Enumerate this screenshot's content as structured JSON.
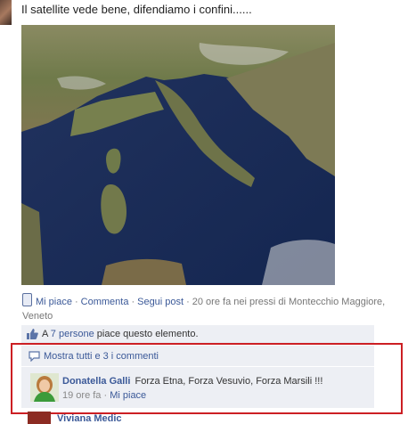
{
  "post": {
    "text": "Il satellite vede bene, difendiamo i confini......",
    "image_alt": "satellite image of Italy"
  },
  "meta": {
    "like_label": "Mi piace",
    "comment_label": "Commenta",
    "follow_label": "Segui post",
    "time_location": "20 ore fa nei pressi di Montecchio Maggiore, Veneto",
    "separator": "·"
  },
  "likes": {
    "prefix": "A",
    "people_link": "7 persone",
    "suffix": "piace questo elemento."
  },
  "comments": {
    "show_all": "Mostra tutti e 3 i commenti",
    "items": [
      {
        "author": "Donatella Galli",
        "text": "Forza Etna, Forza Vesuvio, Forza Marsili !!!",
        "time": "19 ore fa",
        "like_label": "Mi piace"
      }
    ]
  },
  "next_comment": {
    "author_partial": "Viviana Medic"
  },
  "colors": {
    "link": "#3b5998",
    "highlight": "#cc1f24",
    "panel": "#edeff4"
  }
}
